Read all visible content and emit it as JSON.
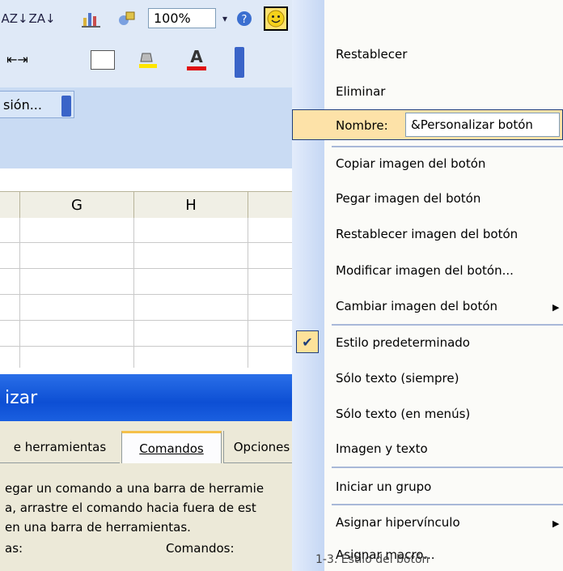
{
  "toolbar": {
    "zoom": "100%",
    "sort_asc_icon": "AZ↓",
    "sort_desc_icon": "ZA↓",
    "chart_icon": "chart",
    "drawing_icon": "drawing",
    "dropdown_icon": "▾",
    "help_icon": "?"
  },
  "toolbar2": {
    "indent_icons": "⇤⇥",
    "font_color_label": "A"
  },
  "session_button": "sión...",
  "columns": [
    "G",
    "H"
  ],
  "dialog": {
    "title": "izar",
    "tabs": [
      "e herramientas",
      "Comandos",
      "Opciones"
    ],
    "description": [
      "egar un comando a una barra de herramie",
      "a, arrastre el comando hacia fuera de est",
      "en una barra de herramientas."
    ],
    "label_left": "as:",
    "label_right": "Comandos:"
  },
  "menu": {
    "items_top": [
      "Restablecer",
      "Eliminar"
    ],
    "nombre_label": "Nombre:",
    "nombre_value": "&Personalizar botón",
    "image_items": [
      "Copiar imagen del botón",
      "Pegar imagen del botón",
      "Restablecer imagen del botón",
      "Modificar imagen del botón...",
      "Cambiar imagen del botón"
    ],
    "style_items": [
      "Estilo predeterminado",
      "Sólo texto (siempre)",
      "Sólo texto (en menús)",
      "Imagen y texto"
    ],
    "group_item": "Iniciar un grupo",
    "link_items": [
      "Asignar hipervínculo",
      "Asignar macro..."
    ]
  },
  "caption": "1-3. Estilo del botón"
}
